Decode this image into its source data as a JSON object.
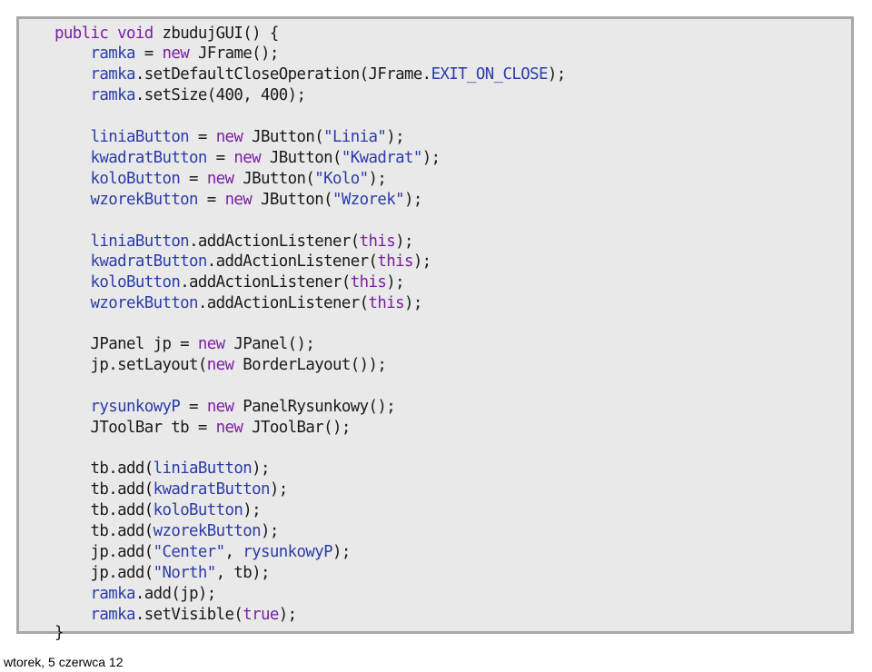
{
  "code": {
    "lines": [
      [
        {
          "t": "public void",
          "c": "kw"
        },
        {
          "t": " zbudujGUI() {",
          "c": "tx"
        }
      ],
      [
        {
          "t": "    ",
          "c": "tx"
        },
        {
          "t": "ramka",
          "c": "fn"
        },
        {
          "t": " = ",
          "c": "tx"
        },
        {
          "t": "new",
          "c": "kw"
        },
        {
          "t": " JFrame();",
          "c": "tx"
        }
      ],
      [
        {
          "t": "    ",
          "c": "tx"
        },
        {
          "t": "ramka",
          "c": "fn"
        },
        {
          "t": ".setDefaultCloseOperation(JFrame.",
          "c": "tx"
        },
        {
          "t": "EXIT_ON_CLOSE",
          "c": "fn"
        },
        {
          "t": ");",
          "c": "tx"
        }
      ],
      [
        {
          "t": "    ",
          "c": "tx"
        },
        {
          "t": "ramka",
          "c": "fn"
        },
        {
          "t": ".setSize(400, 400);",
          "c": "tx"
        }
      ],
      [],
      [
        {
          "t": "    ",
          "c": "tx"
        },
        {
          "t": "liniaButton",
          "c": "fn"
        },
        {
          "t": " = ",
          "c": "tx"
        },
        {
          "t": "new",
          "c": "kw"
        },
        {
          "t": " JButton(",
          "c": "tx"
        },
        {
          "t": "\"Linia\"",
          "c": "st"
        },
        {
          "t": ");",
          "c": "tx"
        }
      ],
      [
        {
          "t": "    ",
          "c": "tx"
        },
        {
          "t": "kwadratButton",
          "c": "fn"
        },
        {
          "t": " = ",
          "c": "tx"
        },
        {
          "t": "new",
          "c": "kw"
        },
        {
          "t": " JButton(",
          "c": "tx"
        },
        {
          "t": "\"Kwadrat\"",
          "c": "st"
        },
        {
          "t": ");",
          "c": "tx"
        }
      ],
      [
        {
          "t": "    ",
          "c": "tx"
        },
        {
          "t": "koloButton",
          "c": "fn"
        },
        {
          "t": " = ",
          "c": "tx"
        },
        {
          "t": "new",
          "c": "kw"
        },
        {
          "t": " JButton(",
          "c": "tx"
        },
        {
          "t": "\"Kolo\"",
          "c": "st"
        },
        {
          "t": ");",
          "c": "tx"
        }
      ],
      [
        {
          "t": "    ",
          "c": "tx"
        },
        {
          "t": "wzorekButton",
          "c": "fn"
        },
        {
          "t": " = ",
          "c": "tx"
        },
        {
          "t": "new",
          "c": "kw"
        },
        {
          "t": " JButton(",
          "c": "tx"
        },
        {
          "t": "\"Wzorek\"",
          "c": "st"
        },
        {
          "t": ");",
          "c": "tx"
        }
      ],
      [],
      [
        {
          "t": "    ",
          "c": "tx"
        },
        {
          "t": "liniaButton",
          "c": "fn"
        },
        {
          "t": ".addActionListener(",
          "c": "tx"
        },
        {
          "t": "this",
          "c": "kw"
        },
        {
          "t": ");",
          "c": "tx"
        }
      ],
      [
        {
          "t": "    ",
          "c": "tx"
        },
        {
          "t": "kwadratButton",
          "c": "fn"
        },
        {
          "t": ".addActionListener(",
          "c": "tx"
        },
        {
          "t": "this",
          "c": "kw"
        },
        {
          "t": ");",
          "c": "tx"
        }
      ],
      [
        {
          "t": "    ",
          "c": "tx"
        },
        {
          "t": "koloButton",
          "c": "fn"
        },
        {
          "t": ".addActionListener(",
          "c": "tx"
        },
        {
          "t": "this",
          "c": "kw"
        },
        {
          "t": ");",
          "c": "tx"
        }
      ],
      [
        {
          "t": "    ",
          "c": "tx"
        },
        {
          "t": "wzorekButton",
          "c": "fn"
        },
        {
          "t": ".addActionListener(",
          "c": "tx"
        },
        {
          "t": "this",
          "c": "kw"
        },
        {
          "t": ");",
          "c": "tx"
        }
      ],
      [],
      [
        {
          "t": "    JPanel jp = ",
          "c": "tx"
        },
        {
          "t": "new",
          "c": "kw"
        },
        {
          "t": " JPanel();",
          "c": "tx"
        }
      ],
      [
        {
          "t": "    jp.setLayout(",
          "c": "tx"
        },
        {
          "t": "new",
          "c": "kw"
        },
        {
          "t": " BorderLayout());",
          "c": "tx"
        }
      ],
      [],
      [
        {
          "t": "    ",
          "c": "tx"
        },
        {
          "t": "rysunkowyP",
          "c": "fn"
        },
        {
          "t": " = ",
          "c": "tx"
        },
        {
          "t": "new",
          "c": "kw"
        },
        {
          "t": " PanelRysunkowy();",
          "c": "tx"
        }
      ],
      [
        {
          "t": "    JToolBar tb = ",
          "c": "tx"
        },
        {
          "t": "new",
          "c": "kw"
        },
        {
          "t": " JToolBar();",
          "c": "tx"
        }
      ],
      [],
      [
        {
          "t": "    tb.add(",
          "c": "tx"
        },
        {
          "t": "liniaButton",
          "c": "fn"
        },
        {
          "t": ");",
          "c": "tx"
        }
      ],
      [
        {
          "t": "    tb.add(",
          "c": "tx"
        },
        {
          "t": "kwadratButton",
          "c": "fn"
        },
        {
          "t": ");",
          "c": "tx"
        }
      ],
      [
        {
          "t": "    tb.add(",
          "c": "tx"
        },
        {
          "t": "koloButton",
          "c": "fn"
        },
        {
          "t": ");",
          "c": "tx"
        }
      ],
      [
        {
          "t": "    tb.add(",
          "c": "tx"
        },
        {
          "t": "wzorekButton",
          "c": "fn"
        },
        {
          "t": ");",
          "c": "tx"
        }
      ],
      [
        {
          "t": "    jp.add(",
          "c": "tx"
        },
        {
          "t": "\"Center\"",
          "c": "st"
        },
        {
          "t": ", ",
          "c": "tx"
        },
        {
          "t": "rysunkowyP",
          "c": "fn"
        },
        {
          "t": ");",
          "c": "tx"
        }
      ],
      [
        {
          "t": "    jp.add(",
          "c": "tx"
        },
        {
          "t": "\"North\"",
          "c": "st"
        },
        {
          "t": ", tb);",
          "c": "tx"
        }
      ],
      [
        {
          "t": "    ",
          "c": "tx"
        },
        {
          "t": "ramka",
          "c": "fn"
        },
        {
          "t": ".add(jp);",
          "c": "tx"
        }
      ],
      [
        {
          "t": "    ",
          "c": "tx"
        },
        {
          "t": "ramka",
          "c": "fn"
        },
        {
          "t": ".setVisible(",
          "c": "tx"
        },
        {
          "t": "true",
          "c": "kw"
        },
        {
          "t": ");",
          "c": "tx"
        }
      ]
    ],
    "closing_brace": "}"
  },
  "footer": {
    "date": "wtorek, 5 czerwca 12"
  },
  "colors": {
    "keyword": "#7b1fa2",
    "identifier": "#2b3ca8",
    "string": "#2b3ca8",
    "text": "#1a1a1a",
    "background": "#e9e9e9",
    "border": "#a8a8a8"
  }
}
